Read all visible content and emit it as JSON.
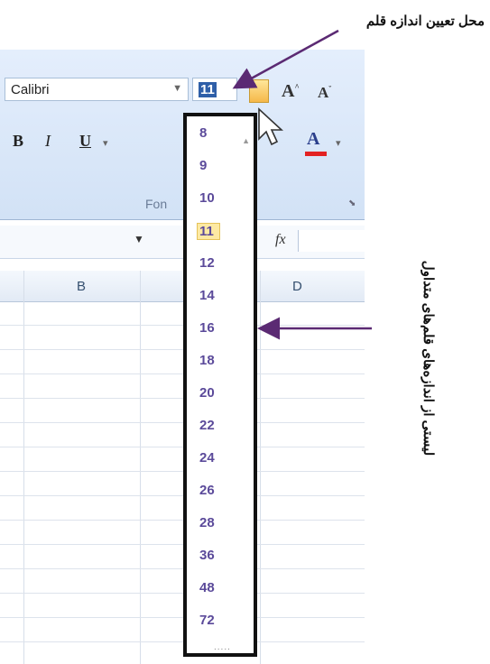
{
  "ribbon": {
    "font_name": "Calibri",
    "font_size": "11",
    "grow_label": "A",
    "shrink_label": "A",
    "bold_label": "B",
    "italic_label": "I",
    "underline_label": "U",
    "font_color_label": "A",
    "group_label": "Fon",
    "font_color_bar": "#e32222"
  },
  "formula_bar": {
    "fx_label": "fx"
  },
  "columns": [
    "B",
    "D"
  ],
  "size_list": {
    "items": [
      "8",
      "9",
      "10",
      "11",
      "12",
      "14",
      "16",
      "18",
      "20",
      "22",
      "24",
      "26",
      "28",
      "36",
      "48",
      "72"
    ],
    "selected": "11",
    "grip": "....."
  },
  "annotations": {
    "top": "محل تعیین اندازه قلم",
    "side": "لیستی از اندازه‌های قلم‌های متداول"
  },
  "colors": {
    "annotation_arrow": "#5b2a73",
    "list_text": "#5b4a9a",
    "selected_bg": "#fde9a3"
  }
}
